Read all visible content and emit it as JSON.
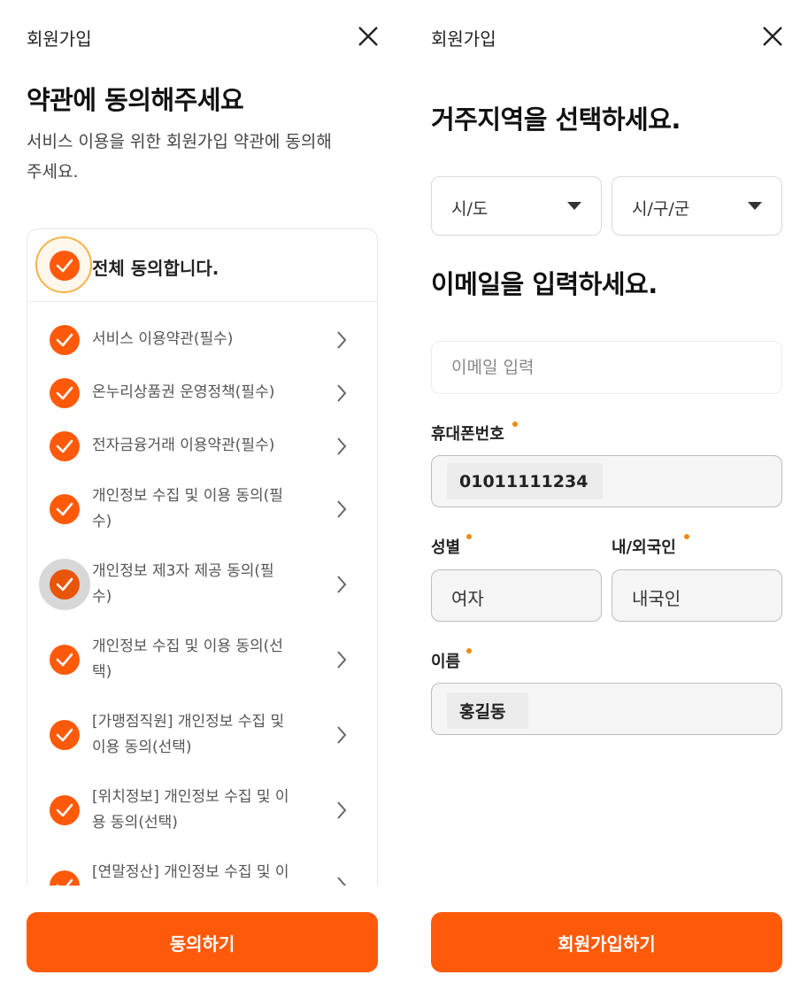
{
  "left": {
    "header_title": "회원가입",
    "title": "약관에 동의해주세요",
    "subtitle_line1": "서비스 이용을 위한 회원가입 약관에 동의해",
    "subtitle_line2": "주세요.",
    "agree_all": "전체 동의합니다.",
    "terms": [
      {
        "line1": "서비스 이용약관(필수)",
        "line2": ""
      },
      {
        "line1": "온누리상품권 운영정책(필수)",
        "line2": ""
      },
      {
        "line1": "전자금융거래 이용약관(필수)",
        "line2": ""
      },
      {
        "line1": "개인정보 수집 및 이용 동의(필",
        "line2": "수)"
      },
      {
        "line1": "개인정보 제3자 제공 동의(필",
        "line2": "수)"
      },
      {
        "line1": "개인정보 수집 및 이용 동의(선",
        "line2": "택)"
      },
      {
        "line1": "[가맹점직원] 개인정보 수집 및",
        "line2": "이용 동의(선택)"
      },
      {
        "line1": "[위치정보] 개인정보 수집 및 이",
        "line2": "용 동의(선택)"
      },
      {
        "line1": "[연말정산] 개인정보 수집 및 이",
        "line2": ""
      }
    ],
    "submit_label": "동의하기"
  },
  "right": {
    "header_title": "회원가입",
    "region_title": "거주지역을 선택하세요.",
    "province_select": "시/도",
    "city_select": "시/구/군",
    "email_title": "이메일을 입력하세요.",
    "email_placeholder": "이메일 입력",
    "phone_label": "휴대폰번호",
    "phone_value": "01011111234",
    "gender_label": "성별",
    "gender_value": "여자",
    "nationality_label": "내/외국인",
    "nationality_value": "내국인",
    "name_label": "이름",
    "name_value": "홍길동",
    "submit_label": "회원가입하기"
  },
  "colors": {
    "accent": "#ff5a0a",
    "required_dot": "#f08a10",
    "focus_ring": "#f6b34a"
  },
  "icons": {
    "close": "close-icon",
    "check": "check-icon",
    "chevron": "chevron-right-icon",
    "caret": "caret-down-icon"
  }
}
